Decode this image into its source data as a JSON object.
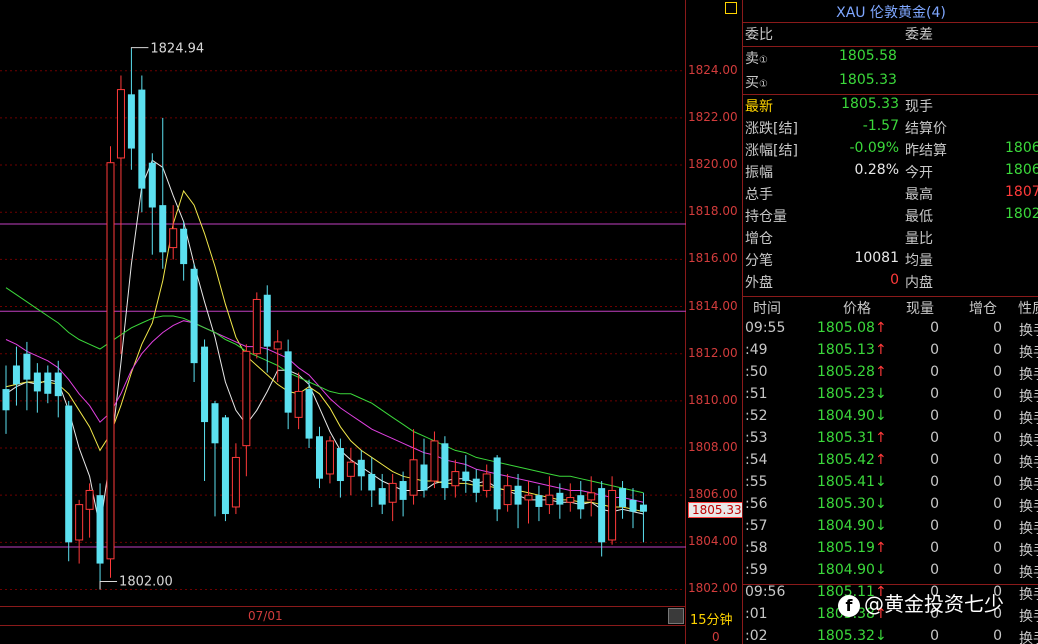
{
  "chart_data": {
    "type": "candlestick",
    "period": "15分钟",
    "x_date_label": "07/01",
    "ylim": [
      1801.3,
      1827.0
    ],
    "y_ticks": [
      "1824.00",
      "1822.00",
      "1820.00",
      "1818.00",
      "1816.00",
      "1814.00",
      "1812.00",
      "1810.00",
      "1808.00",
      "1806.00",
      "1804.00",
      "1802.00"
    ],
    "high_annotation": "1824.94",
    "low_annotation": "1802.00",
    "current_price": "1805.33",
    "horizontal_lines": [
      1817.5,
      1813.8,
      1803.8
    ],
    "candles": [
      {
        "o": 1810.5,
        "c": 1809.6,
        "h": 1811.5,
        "l": 1808.6
      },
      {
        "o": 1811.5,
        "c": 1810.7,
        "h": 1812.3,
        "l": 1809.8
      },
      {
        "o": 1812.0,
        "c": 1810.9,
        "h": 1812.5,
        "l": 1809.6
      },
      {
        "o": 1811.2,
        "c": 1810.4,
        "h": 1811.6,
        "l": 1809.5
      },
      {
        "o": 1811.2,
        "c": 1810.3,
        "h": 1811.5,
        "l": 1809.9
      },
      {
        "o": 1811.2,
        "c": 1810.2,
        "h": 1811.7,
        "l": 1809.3
      },
      {
        "o": 1809.8,
        "c": 1804.0,
        "h": 1810.0,
        "l": 1803.2
      },
      {
        "o": 1804.1,
        "c": 1805.6,
        "h": 1805.8,
        "l": 1803.1
      },
      {
        "o": 1805.4,
        "c": 1806.2,
        "h": 1806.5,
        "l": 1804.2
      },
      {
        "o": 1806.0,
        "c": 1803.1,
        "h": 1806.5,
        "l": 1802.0
      },
      {
        "o": 1803.3,
        "c": 1820.1,
        "h": 1820.8,
        "l": 1802.5
      },
      {
        "o": 1820.3,
        "c": 1823.2,
        "h": 1823.8,
        "l": 1812.0
      },
      {
        "o": 1823.0,
        "c": 1820.7,
        "h": 1824.94,
        "l": 1819.8
      },
      {
        "o": 1823.2,
        "c": 1819.0,
        "h": 1823.8,
        "l": 1818.0
      },
      {
        "o": 1820.1,
        "c": 1818.2,
        "h": 1820.5,
        "l": 1816.2
      },
      {
        "o": 1818.3,
        "c": 1816.3,
        "h": 1822.0,
        "l": 1815.6
      },
      {
        "o": 1816.5,
        "c": 1817.3,
        "h": 1818.3,
        "l": 1816.0
      },
      {
        "o": 1817.3,
        "c": 1815.8,
        "h": 1817.6,
        "l": 1815.1
      },
      {
        "o": 1815.6,
        "c": 1811.6,
        "h": 1815.8,
        "l": 1810.8
      },
      {
        "o": 1812.3,
        "c": 1809.1,
        "h": 1812.6,
        "l": 1806.6
      },
      {
        "o": 1809.9,
        "c": 1808.2,
        "h": 1810.0,
        "l": 1805.1
      },
      {
        "o": 1809.3,
        "c": 1805.2,
        "h": 1809.4,
        "l": 1804.9
      },
      {
        "o": 1805.5,
        "c": 1807.6,
        "h": 1808.2,
        "l": 1805.2
      },
      {
        "o": 1808.1,
        "c": 1812.1,
        "h": 1812.4,
        "l": 1806.8
      },
      {
        "o": 1812.0,
        "c": 1814.3,
        "h": 1814.6,
        "l": 1811.8
      },
      {
        "o": 1814.5,
        "c": 1812.3,
        "h": 1814.9,
        "l": 1811.2
      },
      {
        "o": 1812.2,
        "c": 1812.5,
        "h": 1813.0,
        "l": 1810.8
      },
      {
        "o": 1812.1,
        "c": 1809.5,
        "h": 1812.6,
        "l": 1808.8
      },
      {
        "o": 1809.3,
        "c": 1810.4,
        "h": 1811.2,
        "l": 1808.8
      },
      {
        "o": 1810.5,
        "c": 1808.4,
        "h": 1810.9,
        "l": 1808.0
      },
      {
        "o": 1808.5,
        "c": 1806.7,
        "h": 1808.9,
        "l": 1806.3
      },
      {
        "o": 1806.9,
        "c": 1808.3,
        "h": 1808.5,
        "l": 1806.5
      },
      {
        "o": 1808.0,
        "c": 1806.6,
        "h": 1808.4,
        "l": 1805.9
      },
      {
        "o": 1806.8,
        "c": 1807.4,
        "h": 1808.0,
        "l": 1806.0
      },
      {
        "o": 1807.5,
        "c": 1806.8,
        "h": 1807.9,
        "l": 1806.2
      },
      {
        "o": 1806.9,
        "c": 1806.2,
        "h": 1807.6,
        "l": 1805.5
      },
      {
        "o": 1806.3,
        "c": 1805.6,
        "h": 1806.9,
        "l": 1805.2
      },
      {
        "o": 1805.7,
        "c": 1806.5,
        "h": 1806.9,
        "l": 1804.9
      },
      {
        "o": 1806.6,
        "c": 1805.8,
        "h": 1807.0,
        "l": 1805.1
      },
      {
        "o": 1806.0,
        "c": 1807.5,
        "h": 1808.8,
        "l": 1805.6
      },
      {
        "o": 1807.3,
        "c": 1806.2,
        "h": 1808.4,
        "l": 1805.9
      },
      {
        "o": 1806.6,
        "c": 1808.3,
        "h": 1808.7,
        "l": 1806.3
      },
      {
        "o": 1808.2,
        "c": 1806.3,
        "h": 1808.5,
        "l": 1805.8
      },
      {
        "o": 1806.4,
        "c": 1807.0,
        "h": 1807.5,
        "l": 1805.9
      },
      {
        "o": 1807.0,
        "c": 1806.6,
        "h": 1807.7,
        "l": 1806.1
      },
      {
        "o": 1806.7,
        "c": 1806.1,
        "h": 1807.1,
        "l": 1805.7
      },
      {
        "o": 1806.2,
        "c": 1806.9,
        "h": 1807.3,
        "l": 1805.9
      },
      {
        "o": 1807.6,
        "c": 1805.4,
        "h": 1807.7,
        "l": 1804.9
      },
      {
        "o": 1805.6,
        "c": 1806.4,
        "h": 1806.9,
        "l": 1805.3
      },
      {
        "o": 1806.4,
        "c": 1805.6,
        "h": 1806.9,
        "l": 1804.6
      },
      {
        "o": 1805.8,
        "c": 1806.0,
        "h": 1806.6,
        "l": 1804.8
      },
      {
        "o": 1806.0,
        "c": 1805.5,
        "h": 1806.4,
        "l": 1804.9
      },
      {
        "o": 1805.6,
        "c": 1806.0,
        "h": 1806.8,
        "l": 1805.2
      },
      {
        "o": 1806.1,
        "c": 1805.6,
        "h": 1806.5,
        "l": 1805.0
      },
      {
        "o": 1805.7,
        "c": 1805.9,
        "h": 1806.5,
        "l": 1805.3
      },
      {
        "o": 1806.0,
        "c": 1805.4,
        "h": 1806.6,
        "l": 1805.0
      },
      {
        "o": 1805.8,
        "c": 1806.1,
        "h": 1806.8,
        "l": 1805.1
      },
      {
        "o": 1806.3,
        "c": 1804.0,
        "h": 1806.6,
        "l": 1803.4
      },
      {
        "o": 1804.1,
        "c": 1806.2,
        "h": 1806.8,
        "l": 1803.9
      },
      {
        "o": 1806.3,
        "c": 1805.5,
        "h": 1806.6,
        "l": 1805.0
      },
      {
        "o": 1805.8,
        "c": 1805.3,
        "h": 1806.3,
        "l": 1804.6
      },
      {
        "o": 1805.6,
        "c": 1805.3,
        "h": 1806.1,
        "l": 1804.0
      }
    ],
    "ma_lines": [
      {
        "color": "#e8e8e8",
        "values": [
          1810.3,
          1810.6,
          1810.8,
          1810.7,
          1810.9,
          1810.8,
          1809.6,
          1808.0,
          1806.8,
          1804.6,
          1807.7,
          1811.6,
          1815.8,
          1819.1,
          1820.2,
          1819.9,
          1818.7,
          1817.6,
          1815.8,
          1814.2,
          1812.7,
          1810.8,
          1809.6,
          1809.0,
          1809.6,
          1810.4,
          1811.3,
          1811.3,
          1811.1,
          1810.7,
          1809.7,
          1808.7,
          1807.9,
          1807.5,
          1807.2,
          1806.9,
          1806.6,
          1806.4,
          1806.2,
          1806.2,
          1806.2,
          1806.5,
          1806.6,
          1806.7,
          1806.7,
          1806.5,
          1806.6,
          1806.3,
          1806.2,
          1806.0,
          1805.8,
          1805.8,
          1805.8,
          1805.7,
          1805.7,
          1805.6,
          1805.7,
          1805.4,
          1805.3,
          1805.4,
          1805.3,
          1805.2
        ]
      },
      {
        "color": "#f2e84a",
        "values": [
          1810.6,
          1810.7,
          1810.8,
          1810.8,
          1810.8,
          1810.7,
          1810.3,
          1809.6,
          1808.9,
          1807.9,
          1808.6,
          1809.8,
          1811.2,
          1812.4,
          1813.3,
          1815.1,
          1817.5,
          1818.9,
          1818.3,
          1817.1,
          1815.7,
          1814.1,
          1812.7,
          1811.9,
          1811.5,
          1811.1,
          1810.7,
          1810.4,
          1810.3,
          1810.6,
          1810.3,
          1809.7,
          1808.9,
          1808.3,
          1807.9,
          1807.6,
          1807.3,
          1807.0,
          1806.8,
          1806.7,
          1806.6,
          1806.6,
          1806.5,
          1806.5,
          1806.5,
          1806.4,
          1806.4,
          1806.3,
          1806.2,
          1806.2,
          1806.1,
          1806.0,
          1805.9,
          1805.8,
          1805.8,
          1805.7,
          1805.7,
          1805.6,
          1805.5,
          1805.5,
          1805.4,
          1805.3
        ]
      },
      {
        "color": "#e040e0",
        "values": [
          1812.6,
          1812.4,
          1812.1,
          1811.9,
          1811.7,
          1811.4,
          1810.9,
          1810.3,
          1809.8,
          1809.1,
          1809.5,
          1810.3,
          1811.3,
          1812.0,
          1812.5,
          1812.9,
          1813.2,
          1813.4,
          1813.3,
          1813.1,
          1812.9,
          1812.7,
          1812.5,
          1812.3,
          1812.3,
          1812.2,
          1812.0,
          1811.8,
          1811.4,
          1811.1,
          1810.6,
          1810.1,
          1809.7,
          1809.4,
          1809.1,
          1808.8,
          1808.6,
          1808.4,
          1808.2,
          1808.0,
          1807.8,
          1807.7,
          1807.5,
          1807.4,
          1807.3,
          1807.1,
          1807.0,
          1806.9,
          1806.8,
          1806.7,
          1806.6,
          1806.5,
          1806.4,
          1806.3,
          1806.2,
          1806.2,
          1806.1,
          1806.0,
          1805.9,
          1805.9,
          1805.8,
          1805.7
        ]
      },
      {
        "color": "#3bd83b",
        "values": [
          1814.8,
          1814.5,
          1814.2,
          1813.9,
          1813.6,
          1813.3,
          1812.9,
          1812.6,
          1812.4,
          1812.2,
          1812.5,
          1812.8,
          1813.1,
          1813.3,
          1813.5,
          1813.6,
          1813.6,
          1813.5,
          1813.3,
          1813.1,
          1812.9,
          1812.6,
          1812.4,
          1812.1,
          1811.9,
          1811.7,
          1811.5,
          1811.2,
          1811.0,
          1810.8,
          1810.6,
          1810.4,
          1810.3,
          1810.3,
          1810.1,
          1809.9,
          1809.6,
          1809.3,
          1809.0,
          1808.7,
          1808.5,
          1808.3,
          1808.1,
          1807.9,
          1807.8,
          1807.6,
          1807.5,
          1807.4,
          1807.3,
          1807.2,
          1807.1,
          1807.0,
          1806.9,
          1806.8,
          1806.8,
          1806.7,
          1806.6,
          1806.5,
          1806.4,
          1806.3,
          1806.2,
          1806.1
        ]
      }
    ]
  },
  "panel": {
    "title": "XAU 伦敦黄金(4)",
    "weibi_label": "委比",
    "weicha_label": "委差",
    "sell_label": "卖",
    "sell_price": "1805.58",
    "buy_label": "买",
    "buy_price": "1805.33",
    "stats": [
      {
        "l1": "最新",
        "v1": "1805.33",
        "l2": "现手",
        "v2": ""
      },
      {
        "l1": "涨跌[结]",
        "v1": "-1.57",
        "l2": "结算价",
        "v2": ""
      },
      {
        "l1": "涨幅[结]",
        "v1": "-0.09%",
        "l2": "昨结算",
        "v2": "1806"
      },
      {
        "l1": "振幅",
        "v1": "0.28%",
        "l2": "今开",
        "v2": "1806"
      },
      {
        "l1": "总手",
        "v1": "",
        "l2": "最高",
        "v2": "1807"
      },
      {
        "l1": "持仓量",
        "v1": "",
        "l2": "最低",
        "v2": "1802"
      },
      {
        "l1": "增仓",
        "v1": "",
        "l2": "量比",
        "v2": ""
      },
      {
        "l1": "分笔",
        "v1": "10081",
        "l2": "均量",
        "v2": ""
      },
      {
        "l1": "外盘",
        "v1": "0",
        "l2": "内盘",
        "v2": ""
      }
    ],
    "tick_headers": [
      "时间",
      "价格",
      "现量",
      "增仓",
      "性质"
    ],
    "ticks": [
      {
        "t": "09:55",
        "p": "1805.08",
        "a": "↑",
        "q": "0",
        "z": "0",
        "n": "换手"
      },
      {
        "t": ":49",
        "p": "1805.13",
        "a": "↑",
        "q": "0",
        "z": "0",
        "n": "换手"
      },
      {
        "t": ":50",
        "p": "1805.28",
        "a": "↑",
        "q": "0",
        "z": "0",
        "n": "换手"
      },
      {
        "t": ":51",
        "p": "1805.23",
        "a": "↓",
        "q": "0",
        "z": "0",
        "n": "换手"
      },
      {
        "t": ":52",
        "p": "1804.90",
        "a": "↓",
        "q": "0",
        "z": "0",
        "n": "换手"
      },
      {
        "t": ":53",
        "p": "1805.31",
        "a": "↑",
        "q": "0",
        "z": "0",
        "n": "换手"
      },
      {
        "t": ":54",
        "p": "1805.42",
        "a": "↑",
        "q": "0",
        "z": "0",
        "n": "换手"
      },
      {
        "t": ":55",
        "p": "1805.41",
        "a": "↓",
        "q": "0",
        "z": "0",
        "n": "换手"
      },
      {
        "t": ":56",
        "p": "1805.30",
        "a": "↓",
        "q": "0",
        "z": "0",
        "n": "换手"
      },
      {
        "t": ":57",
        "p": "1804.90",
        "a": "↓",
        "q": "0",
        "z": "0",
        "n": "换手"
      },
      {
        "t": ":58",
        "p": "1805.19",
        "a": "↑",
        "q": "0",
        "z": "0",
        "n": "换手"
      },
      {
        "t": ":59",
        "p": "1804.90",
        "a": "↓",
        "q": "0",
        "z": "0",
        "n": "换手"
      },
      {
        "t": "09:56",
        "p": "1805.11",
        "a": "↑",
        "q": "0",
        "z": "0",
        "n": "换手"
      },
      {
        "t": ":01",
        "p": "1805.38",
        "a": "↑",
        "q": "0",
        "z": "0",
        "n": "换手"
      },
      {
        "t": ":02",
        "p": "1805.32",
        "a": "↓",
        "q": "0",
        "z": "0",
        "n": "换手"
      }
    ]
  },
  "watermark": "@黄金投资七少",
  "colors": {
    "up": "#ff3a3a",
    "down": "#5ce0f0",
    "axis_text": "#d23c3c",
    "grid": "#6e0000",
    "hline": "#c040c0",
    "green_text": "#3bd83b",
    "red_text": "#ff3a3a",
    "label_text": "#c8c8c8",
    "title": "#7fa7ff"
  }
}
